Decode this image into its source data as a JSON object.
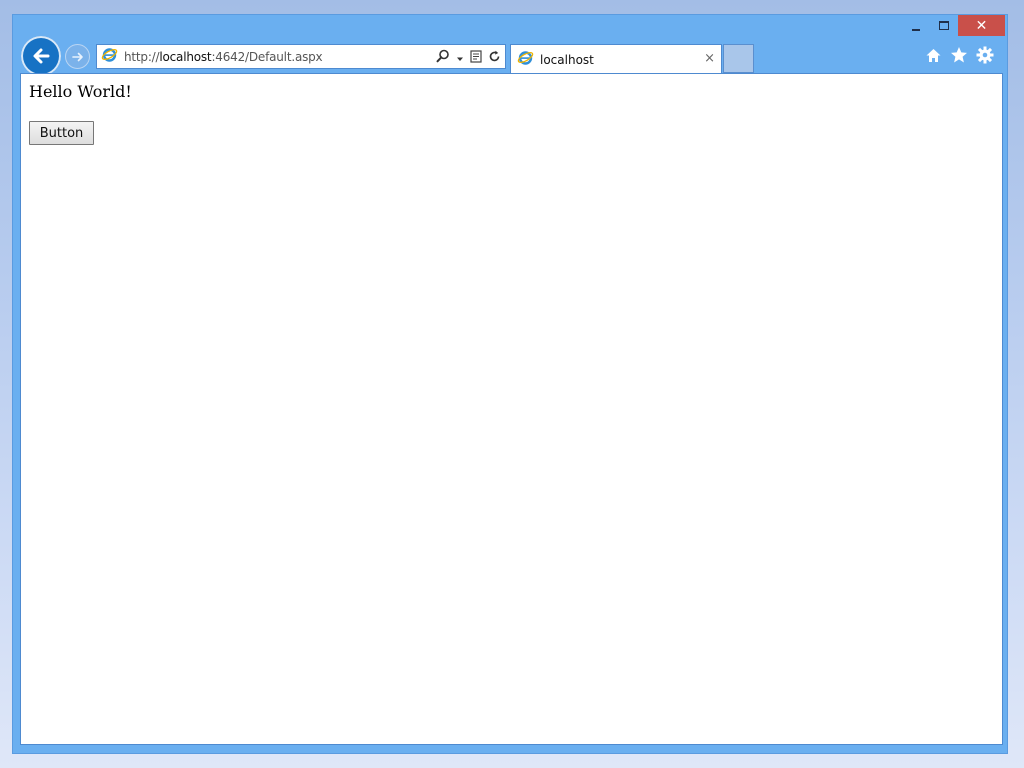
{
  "browser": {
    "address": {
      "scheme": "http://",
      "host": "localhost",
      "rest": ":4642/Default.aspx"
    },
    "tab": {
      "title": "localhost",
      "close_glyph": "×"
    },
    "caption": {
      "close_glyph": "✕"
    },
    "icons": {
      "back": "back-arrow-icon",
      "forward": "forward-arrow-icon",
      "search": "search-icon",
      "dropdown": "dropdown-icon",
      "compat": "compatibility-view-icon",
      "refresh": "refresh-icon",
      "home": "home-icon",
      "favorites": "star-icon",
      "tools": "gear-icon"
    },
    "colors": {
      "frame": "#6aaff0",
      "close_button": "#c9504a",
      "back_button": "#1772c4"
    }
  },
  "page": {
    "heading": "Hello World!",
    "button_label": "Button"
  }
}
